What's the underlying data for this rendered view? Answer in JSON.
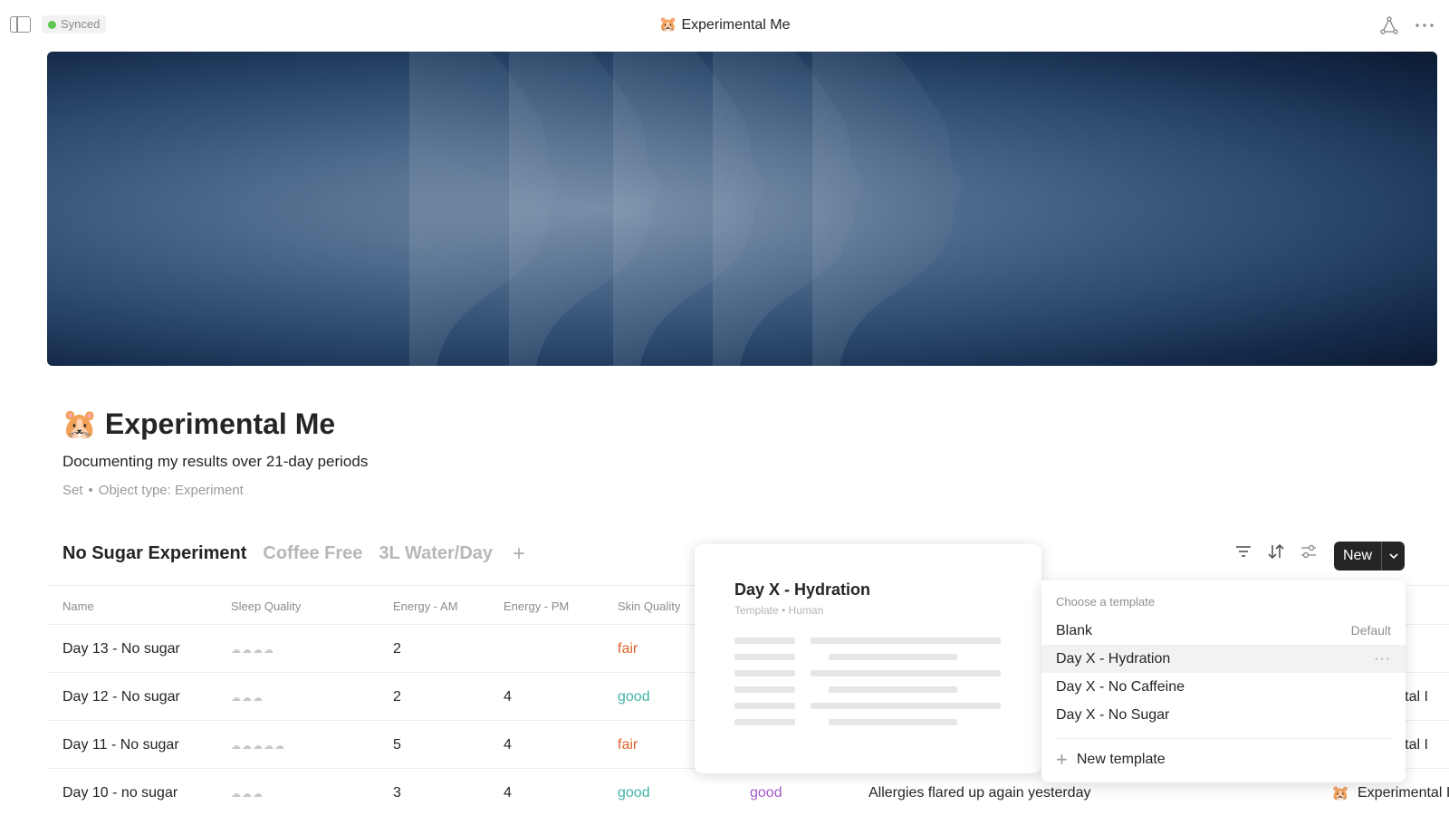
{
  "topbar": {
    "sync_status": "Synced",
    "title_emoji": "🐹",
    "title": "Experimental Me",
    "icons": [
      "sidebar-toggle-icon",
      "graph-icon",
      "more-icon"
    ]
  },
  "header": {
    "emoji": "🐹",
    "title": "Experimental Me",
    "description": "Documenting my results over 21-day periods",
    "meta_type": "Set",
    "meta_separator": "•",
    "meta_object_type": "Object type: Experiment"
  },
  "views": {
    "tabs": [
      {
        "label": "No Sugar Experiment",
        "active": true
      },
      {
        "label": "Coffee Free",
        "active": false
      },
      {
        "label": "3L Water/Day",
        "active": false
      }
    ],
    "add_label": "+"
  },
  "toolbar": {
    "new_label": "New",
    "icons": [
      "filter-icon",
      "sort-icon",
      "settings-icon",
      "chevron-down-icon"
    ]
  },
  "table": {
    "columns": [
      "Name",
      "Sleep Quality",
      "Energy - AM",
      "Energy - PM",
      "Skin Quality"
    ],
    "rows": [
      {
        "name": "Day 13 - No sugar",
        "sleep": "☁☁☁☁",
        "energy_am": "2",
        "energy_pm": "",
        "skin": "fair",
        "extra": "",
        "note": "",
        "link": ""
      },
      {
        "name": "Day 12 - No sugar",
        "sleep": "☁☁☁",
        "energy_am": "2",
        "energy_pm": "4",
        "skin": "good",
        "extra": "",
        "note": "",
        "link": "mental I"
      },
      {
        "name": "Day 11 - No sugar",
        "sleep": "☁☁☁☁☁",
        "energy_am": "5",
        "energy_pm": "4",
        "skin": "fair",
        "extra": "",
        "note": "",
        "link": "mental I"
      },
      {
        "name": "Day 10 - no sugar",
        "sleep": "☁☁☁",
        "energy_am": "3",
        "energy_pm": "4",
        "skin": "good",
        "extra": "good",
        "note": "Allergies flared up again yesterday",
        "link": "Experimental I"
      }
    ],
    "link_emoji": "🐹"
  },
  "preview": {
    "title": "Day X - Hydration",
    "subtitle": "Template • Human"
  },
  "template_menu": {
    "heading": "Choose a template",
    "items": [
      {
        "label": "Blank",
        "badge": "Default"
      },
      {
        "label": "Day X - Hydration",
        "badge": "···"
      },
      {
        "label": "Day X - No Caffeine",
        "badge": ""
      },
      {
        "label": "Day X - No Sugar",
        "badge": ""
      }
    ],
    "new_template": "New template"
  },
  "colors": {
    "fair": "#e0622c",
    "good": "#3fb3a6",
    "good_alt": "#a05bc8",
    "synced_dot": "#5ec74f",
    "button_dark": "#252525"
  }
}
